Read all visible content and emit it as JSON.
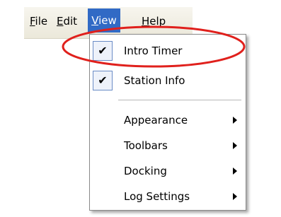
{
  "menubar": {
    "items": [
      {
        "label": "File",
        "mnemonic": "F",
        "rest": "ile"
      },
      {
        "label": "Edit",
        "mnemonic": "E",
        "rest": "dit"
      },
      {
        "label": "View",
        "mnemonic": "V",
        "rest": "iew"
      },
      {
        "label": "Help",
        "mnemonic": "H",
        "rest": "elp"
      }
    ]
  },
  "view_menu": {
    "items": [
      {
        "label": "Intro Timer",
        "checked": true,
        "check_glyph": "✔"
      },
      {
        "label": "Station Info",
        "checked": true,
        "check_glyph": "✔"
      },
      {
        "label": "Appearance",
        "submenu": true
      },
      {
        "label": "Toolbars",
        "submenu": true
      },
      {
        "label": "Docking",
        "submenu": true
      },
      {
        "label": "Log Settings",
        "submenu": true
      }
    ]
  },
  "colors": {
    "highlight": "#316ac5",
    "annotation_ellipse": "#e0201c"
  }
}
